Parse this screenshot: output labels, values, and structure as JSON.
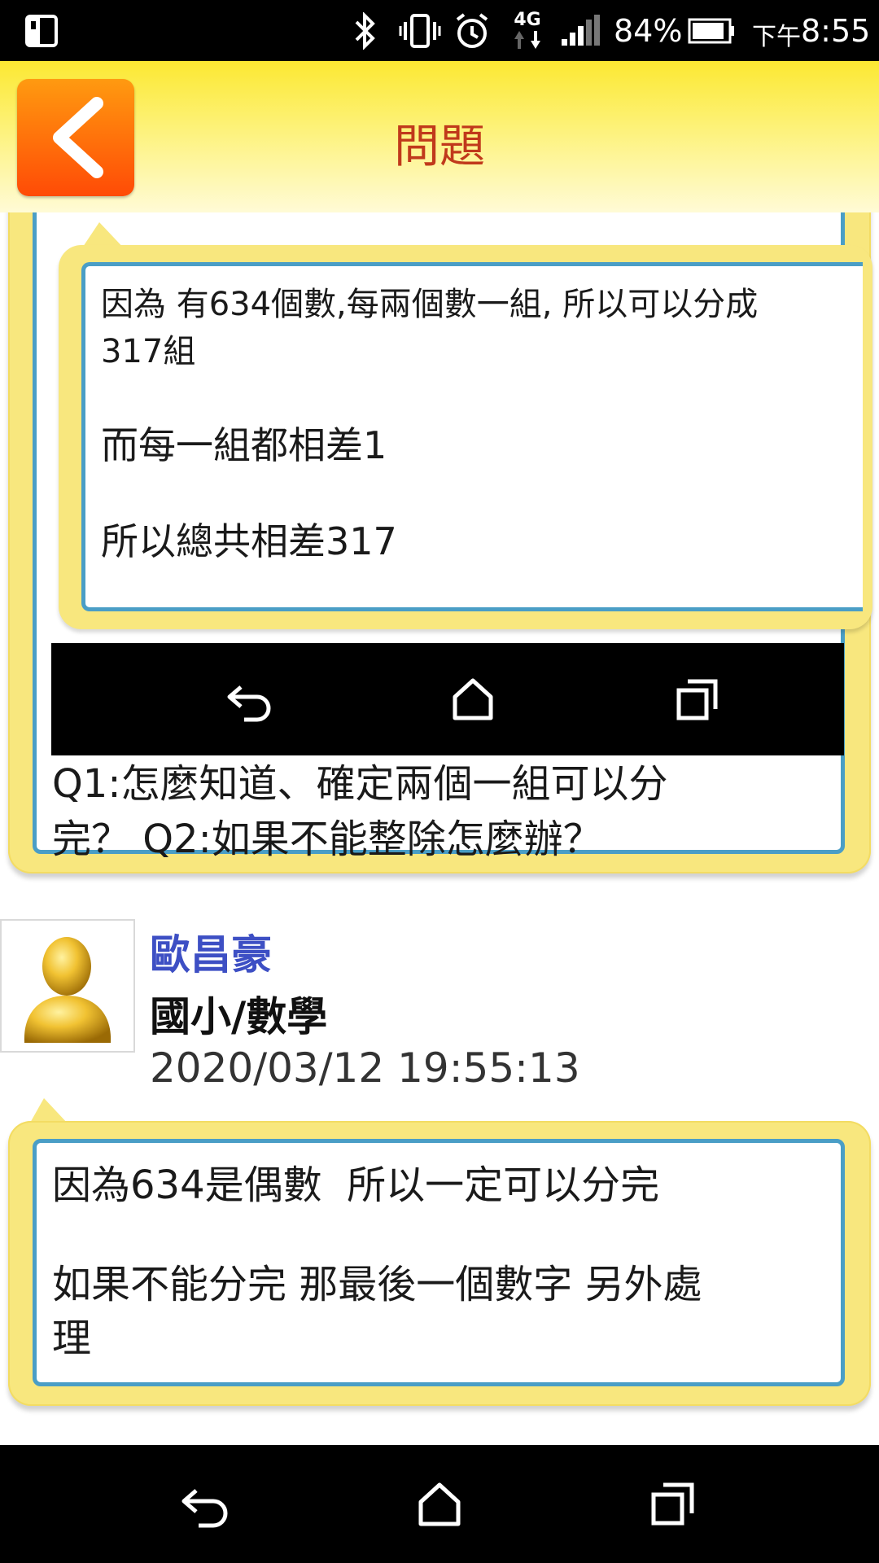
{
  "status_bar": {
    "battery": "84%",
    "ampm": "下午",
    "time": "8:55",
    "network": "4G",
    "icons": [
      "sim-icon",
      "bluetooth-icon",
      "vibrate-icon",
      "alarm-icon",
      "network-4g-icon",
      "signal-icon",
      "battery-icon"
    ]
  },
  "header": {
    "title": "問題",
    "back_icon": "chevron-left-icon"
  },
  "thread": {
    "answer1": {
      "lines": [
        "因為 有634個數,每兩個數一組, 所以可以分成",
        "317組",
        "而每一組都相差1",
        "所以總共相差317"
      ]
    },
    "question": {
      "lines": [
        "Q1:怎麼知道、確定兩個一組可以分",
        "完？ Q2:如果不能整除怎麼辦？"
      ]
    },
    "reply": {
      "author": "歐昌豪",
      "subject": "國小/數學",
      "timestamp": "2020/03/12 19:55:13",
      "lines": [
        "因為634是偶數  所以一定可以分完",
        "如果不能分完 那最後一個數字 另外處",
        "理"
      ]
    }
  },
  "nav_bar": {
    "buttons": [
      "back-icon",
      "home-icon",
      "recents-icon"
    ]
  },
  "colors": {
    "header_yellow": "#fce832",
    "title": "#c0391b",
    "author": "#3d4fc4",
    "bubble": "#f8e77e",
    "border_blue": "#4a9ec6"
  }
}
